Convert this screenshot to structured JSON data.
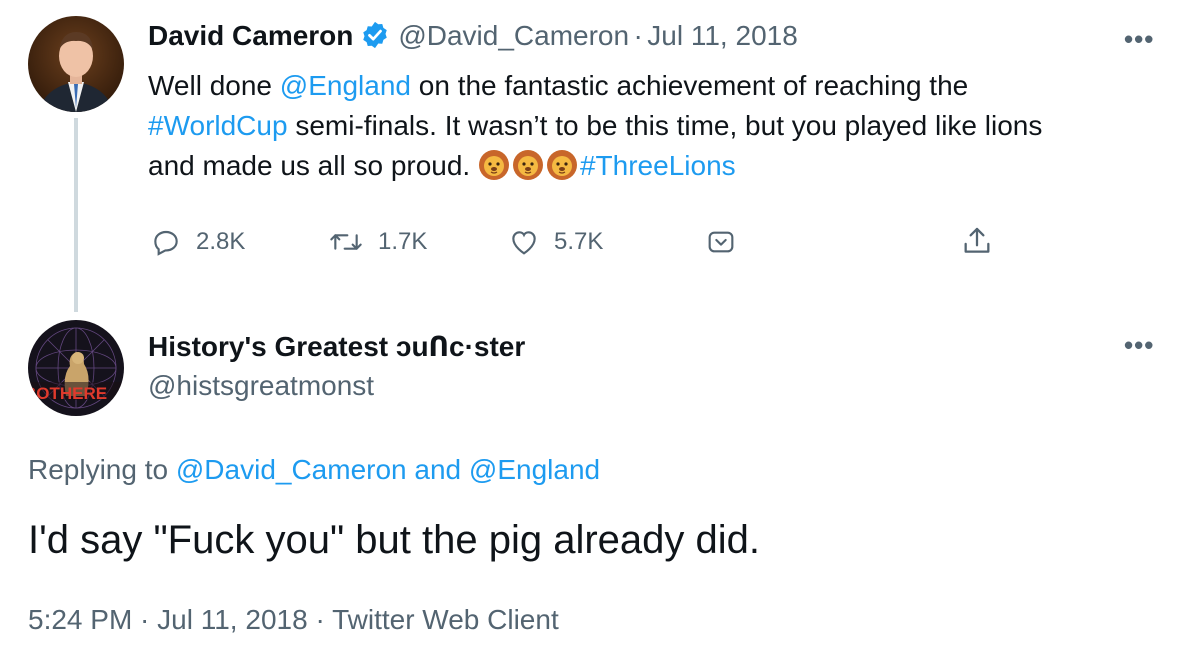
{
  "tweet1": {
    "author_name": "David Cameron",
    "handle": "@David_Cameron",
    "separator": "·",
    "date": "Jul 11, 2018",
    "more": "•••",
    "text_part1": "Well done ",
    "mention": "@England",
    "text_part2": " on the fantastic achievement of reaching the",
    "hashtag1": "#WorldCup",
    "text_part3": " semi-finals. It wasn’t to be this time, but you played like lions",
    "text_part4": "and made us all so proud. ",
    "emoji": "lion-face",
    "hashtag2": "#ThreeLions",
    "reply_count": "2.8K",
    "retweet_count": "1.7K",
    "like_count": "5.7K",
    "verified_color": "#1d9bf0"
  },
  "tweet2": {
    "author_name": "History's Greatest ɔuՈc·ster",
    "handle": "@histsgreatmonst",
    "more": "•••",
    "avatar_text": "BOTHERE",
    "replying_prefix": "Replying to ",
    "replying_user1": "@David_Cameron",
    "replying_and": " and ",
    "replying_user2": "@England",
    "text": "I'd say \"Fuck you\" but the pig already did.",
    "time": "5:24 PM",
    "sep1": " · ",
    "date": "Jul 11, 2018",
    "sep2": " · ",
    "client": "Twitter Web Client"
  },
  "colors": {
    "link": "#1d9bf0",
    "secondary": "#536471",
    "text": "#0f1419"
  }
}
